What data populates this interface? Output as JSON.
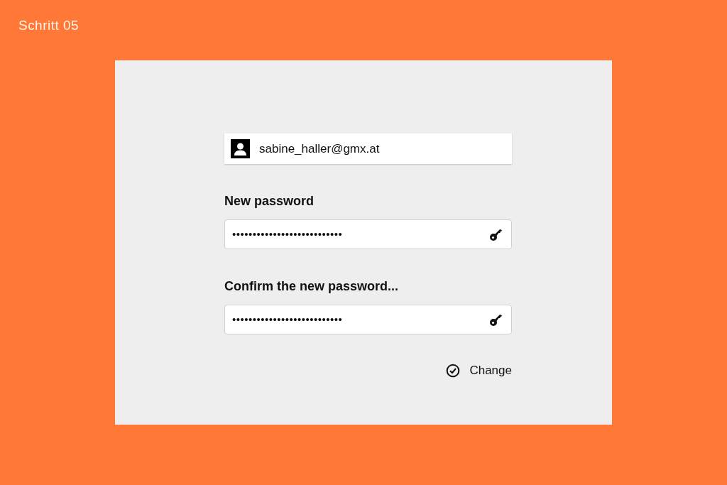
{
  "step_label": "Schritt 05",
  "account": {
    "email": "sabine_haller@gmx.at"
  },
  "fields": [
    {
      "label": "New password",
      "value": "•••••••••••••••••••••••••••"
    },
    {
      "label": "Confirm the new password...",
      "value": "•••••••••••••••••••••••••••"
    }
  ],
  "submit_button": {
    "label": "Change"
  }
}
